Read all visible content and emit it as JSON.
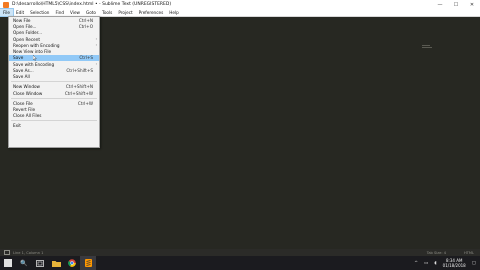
{
  "window": {
    "title": "D:\\desarrollo\\HTML5\\CSS\\index.html • - Sublime Text (UNREGISTERED)",
    "minimize": "—",
    "maximize": "☐",
    "close": "✕"
  },
  "menubar": {
    "items": [
      "File",
      "Edit",
      "Selection",
      "Find",
      "View",
      "Goto",
      "Tools",
      "Project",
      "Preferences",
      "Help"
    ]
  },
  "file_menu": {
    "items": [
      {
        "label": "New File",
        "shortcut": "Ctrl+N"
      },
      {
        "label": "Open File...",
        "shortcut": "Ctrl+O"
      },
      {
        "label": "Open Folder...",
        "shortcut": ""
      },
      {
        "label": "Open Recent",
        "shortcut": "",
        "submenu": true
      },
      {
        "label": "Reopen with Encoding",
        "shortcut": "",
        "submenu": true
      },
      {
        "label": "New View into File",
        "shortcut": ""
      },
      {
        "label": "Save",
        "shortcut": "Ctrl+S",
        "highlight": true
      },
      {
        "label": "Save with Encoding",
        "shortcut": "",
        "submenu": true
      },
      {
        "label": "Save As...",
        "shortcut": "Ctrl+Shift+S"
      },
      {
        "label": "Save All",
        "shortcut": ""
      },
      {
        "label": "New Window",
        "shortcut": "Ctrl+Shift+N"
      },
      {
        "label": "Close Window",
        "shortcut": "Ctrl+Shift+W"
      },
      {
        "label": "Close File",
        "shortcut": "Ctrl+W"
      },
      {
        "label": "Revert File",
        "shortcut": ""
      },
      {
        "label": "Close All Files",
        "shortcut": ""
      },
      {
        "label": "Exit",
        "shortcut": ""
      }
    ]
  },
  "statusbar": {
    "left": "Line 1, Column 1",
    "tab_size": "Tab Size: 4",
    "syntax": "HTML"
  },
  "taskbar": {
    "search_icon": "🔍",
    "time": "8:34 AM",
    "date": "01/18/2018"
  }
}
